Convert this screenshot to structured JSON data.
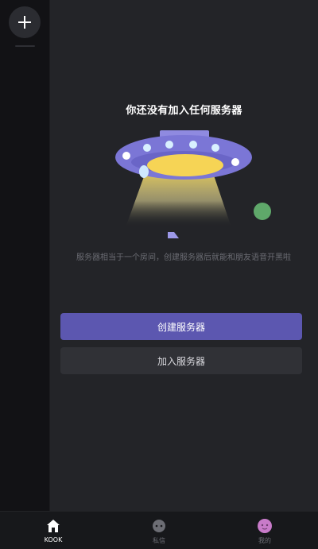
{
  "rail": {
    "add_button_icon": "plus-icon"
  },
  "main": {
    "headline": "你还没有加入任何服务器",
    "description": "服务器相当于一个房间，创建服务器后就能和朋友语音开黑啦",
    "illustration": "ufo-illustration",
    "create_button": "创建服务器",
    "join_button": "加入服务器"
  },
  "bottom_nav": {
    "items": [
      {
        "label": "KOOK",
        "icon": "home-icon",
        "active": true
      },
      {
        "label": "私信",
        "icon": "message-icon",
        "active": false
      },
      {
        "label": "我的",
        "icon": "avatar-icon",
        "active": false
      }
    ]
  },
  "colors": {
    "accent": "#5c57b0",
    "panel": "#232428",
    "rail": "#121215"
  }
}
